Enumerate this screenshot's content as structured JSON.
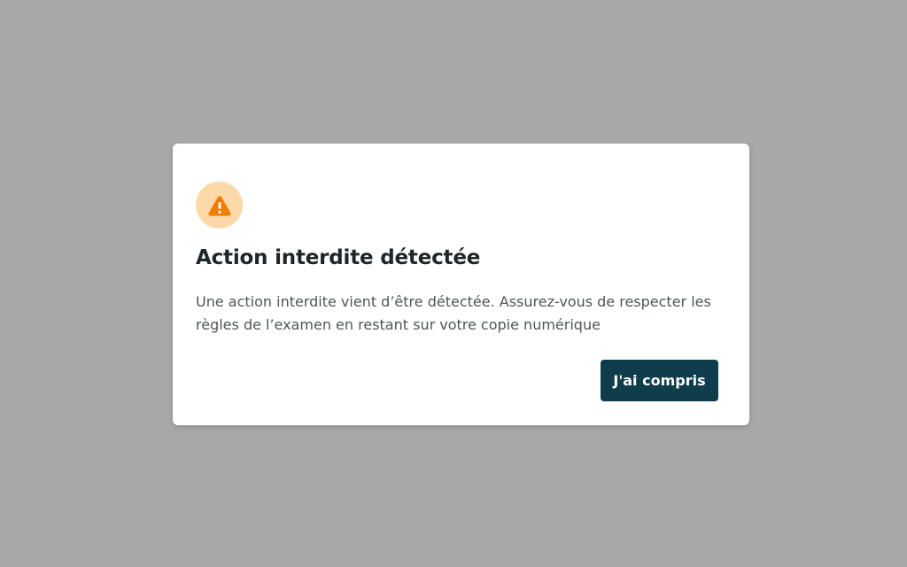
{
  "colors": {
    "backdrop": "#a9a8a9",
    "modal_background": "#ffffff",
    "icon_circle": "#fdd9a9",
    "warning_orange": "#f07c00",
    "title_text": "#1f2528",
    "body_text": "#4f5559",
    "button_background": "#0f3d4c",
    "button_text": "#ffffff"
  },
  "dialog": {
    "icon": "warning-triangle-icon",
    "title": "Action interdite détectée",
    "message": "Une action interdite vient d’être détectée. Assurez-vous de respecter les règles de l’examen en restant sur votre copie numérique",
    "confirm_label": "J'ai compris"
  }
}
